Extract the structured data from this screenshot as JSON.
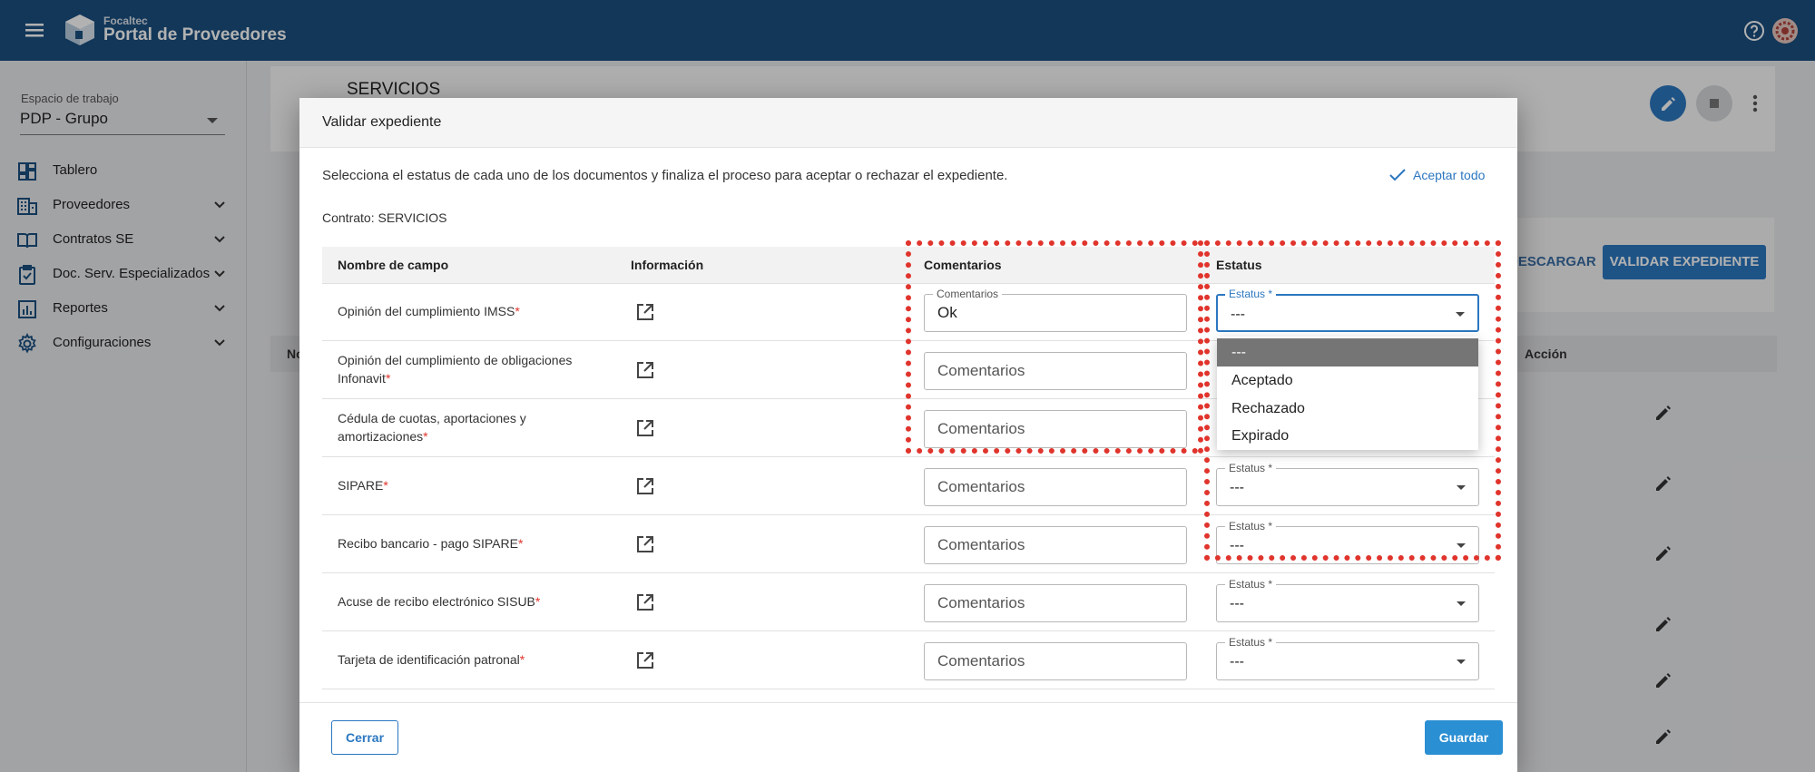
{
  "topbar": {
    "brand_small": "Focaltec",
    "brand_title": "Portal de Proveedores"
  },
  "sidebar": {
    "workspace_label": "Espacio de trabajo",
    "workspace_value": "PDP - Grupo",
    "items": [
      {
        "label": "Tablero",
        "icon": "dashboard-icon",
        "expandable": false
      },
      {
        "label": "Proveedores",
        "icon": "building-icon",
        "expandable": true
      },
      {
        "label": "Contratos SE",
        "icon": "book-icon",
        "expandable": true
      },
      {
        "label": "Doc. Serv. Especializados",
        "icon": "clipboard-check-icon",
        "expandable": true
      },
      {
        "label": "Reportes",
        "icon": "bar-chart-icon",
        "expandable": true
      },
      {
        "label": "Configuraciones",
        "icon": "gear-icon",
        "expandable": true
      }
    ]
  },
  "background": {
    "section_title": "SERVICIOS",
    "descargar_label": "DESCARGAR",
    "validar_label": "VALIDAR EXPEDIENTE",
    "table_first_col": "No",
    "table_action_col": "Acción"
  },
  "modal": {
    "title": "Validar expediente",
    "intro": "Selecciona el estatus de cada uno de los documentos y finaliza el proceso para aceptar o rechazar el expediente.",
    "accept_all": "Aceptar todo",
    "contract": "Contrato: SERVICIOS",
    "columns": {
      "name": "Nombre de campo",
      "info": "Información",
      "comments": "Comentarios",
      "status": "Estatus"
    },
    "comments_placeholder": "Comentarios",
    "comments_label": "Comentarios",
    "status_label": "Estatus *",
    "rows": [
      {
        "name": "Opinión del cumplimiento IMSS",
        "name2": "",
        "comment": "Ok",
        "status": "---"
      },
      {
        "name": "Opinión del cumplimiento de obligaciones",
        "name2": "Infonavit",
        "comment": "",
        "status": "---"
      },
      {
        "name": "Cédula de cuotas, aportaciones y",
        "name2": "amortizaciones",
        "comment": "",
        "status": "---"
      },
      {
        "name": "SIPARE",
        "name2": "",
        "comment": "",
        "status": "---"
      },
      {
        "name": "Recibo bancario - pago SIPARE",
        "name2": "",
        "comment": "",
        "status": "---"
      },
      {
        "name": "Acuse de recibo electrónico SISUB",
        "name2": "",
        "comment": "",
        "status": "---"
      },
      {
        "name": "Tarjeta de identificación patronal",
        "name2": "",
        "comment": "",
        "status": "---"
      }
    ],
    "dropdown_options": [
      "---",
      "Aceptado",
      "Rechazado",
      "Expirado"
    ],
    "close_label": "Cerrar",
    "save_label": "Guardar"
  },
  "colors": {
    "brand": "#1b4f80",
    "accent": "#2b77c0",
    "highlight": "#e0342c",
    "required": "#e0342c"
  }
}
